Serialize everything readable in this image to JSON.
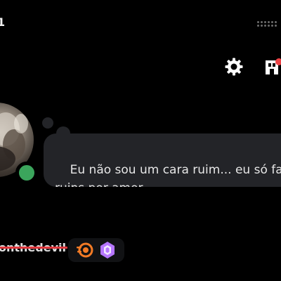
{
  "status_bar": {
    "time_fragment": "1",
    "signal_icon": "signal-dots-icon"
  },
  "header": {
    "settings_icon": "gear-icon",
    "shop_icon": "shop-icon",
    "shop_notification_color": "#ed4245"
  },
  "profile": {
    "avatar_icon": "user-avatar",
    "online_status_color": "#3ba55c",
    "custom_status": "Eu não sou um cara ruim... eu só faço coisas\nruins por amor.",
    "username": "onthedevil",
    "username_strike_color": "#e0373d",
    "badges": [
      {
        "icon": "quest-badge-icon",
        "color": "#f47b25"
      },
      {
        "icon": "nitro-badge-icon",
        "color": "#b676ff"
      }
    ]
  }
}
